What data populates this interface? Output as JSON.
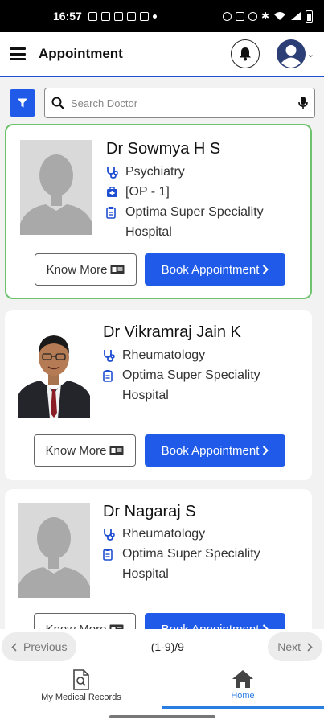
{
  "status_bar": {
    "time": "16:57"
  },
  "header": {
    "title": "Appointment"
  },
  "search": {
    "placeholder": "Search Doctor"
  },
  "doctors": [
    {
      "name": "Dr Sowmya H S",
      "specialty": "Psychiatry",
      "room": "[OP - 1]",
      "hospital_line1": "Optima Super Speciality",
      "hospital_line2": "Hospital",
      "know_more": "Know More",
      "book": "Book Appointment"
    },
    {
      "name": "Dr Vikramraj Jain K",
      "specialty": "Rheumatology",
      "hospital_line1": "Optima Super Speciality",
      "hospital_line2": "Hospital",
      "know_more": "Know More",
      "book": "Book Appointment"
    },
    {
      "name": "Dr Nagaraj S",
      "specialty": "Rheumatology",
      "hospital_line1": "Optima Super Speciality",
      "hospital_line2": "Hospital",
      "know_more": "Know More",
      "book": "Book Appointment"
    }
  ],
  "pagination": {
    "previous": "Previous",
    "count": "(1-9)/9",
    "next": "Next"
  },
  "bottom_nav": {
    "records": "My Medical Records",
    "home": "Home"
  },
  "colors": {
    "primary": "#1f5be8",
    "selected_border": "#6fc36f",
    "tab_active": "#2a7de1"
  },
  "icons": [
    "menu-icon",
    "bell-icon",
    "account-icon",
    "filter-icon",
    "search-icon",
    "mic-icon",
    "stethoscope-icon",
    "medical-kit-icon",
    "clipboard-icon",
    "id-card-icon",
    "chevron-right-icon",
    "chevron-left-icon",
    "file-search-icon",
    "home-icon"
  ]
}
